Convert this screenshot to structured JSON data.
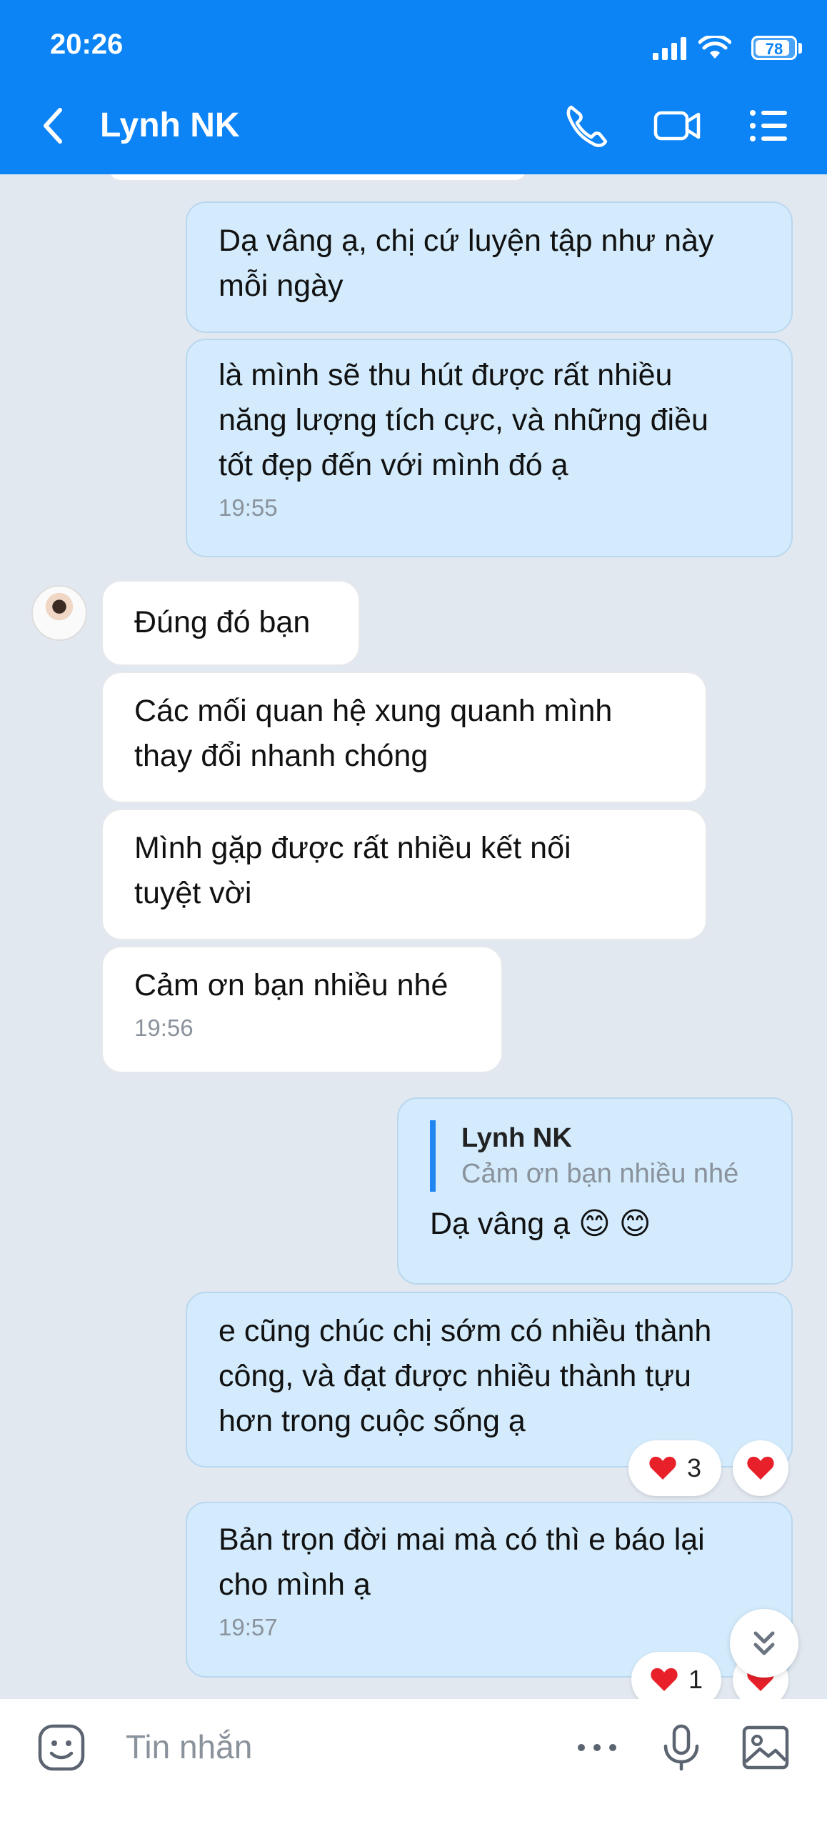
{
  "status_bar": {
    "time": "20:26",
    "battery": "78"
  },
  "header": {
    "title": "Lynh NK"
  },
  "messages": [
    {
      "text": "Dạ vâng ạ, chị cứ luyện tập như này\nmỗi ngày"
    },
    {
      "text": "là mình sẽ thu hút được rất nhiều\nnăng lượng tích cực, và những điều\ntốt đẹp đến với mình đó ạ",
      "time": "19:55"
    },
    {
      "text": "Đúng đó bạn"
    },
    {
      "text": "Các mối quan hệ xung quanh mình\nthay đổi nhanh chóng"
    },
    {
      "text": "Mình gặp được rất nhiều kết nối\ntuyệt vời"
    },
    {
      "text": "Cảm ơn bạn nhiều nhé",
      "time": "19:56"
    },
    {
      "quote_name": "Lynh NK",
      "quote_text": "Cảm ơn bạn nhiều nhé",
      "text": "Dạ vâng ạ 😊 😊"
    },
    {
      "text": "e cũng chúc chị sớm có nhiều thành\ncông, và đạt được nhiều thành tựu\nhơn trong cuộc sống ạ",
      "reaction_count": "3"
    },
    {
      "text": "Bản trọn đời mai mà có thì e báo lại\ncho mình ạ",
      "time": "19:57",
      "reaction_count": "1"
    }
  ],
  "composer": {
    "placeholder": "Tin nhắn"
  },
  "colors": {
    "header": "#0c84f5",
    "my_bubble": "#d3ebfc",
    "their_bubble": "#ffffff",
    "heart": "#e8202a"
  },
  "icons": [
    "back-icon",
    "phone-icon",
    "video-icon",
    "menu-icon",
    "sticker-icon",
    "more-icon",
    "mic-icon",
    "image-icon",
    "heart-icon",
    "chevron-double-down-icon"
  ]
}
